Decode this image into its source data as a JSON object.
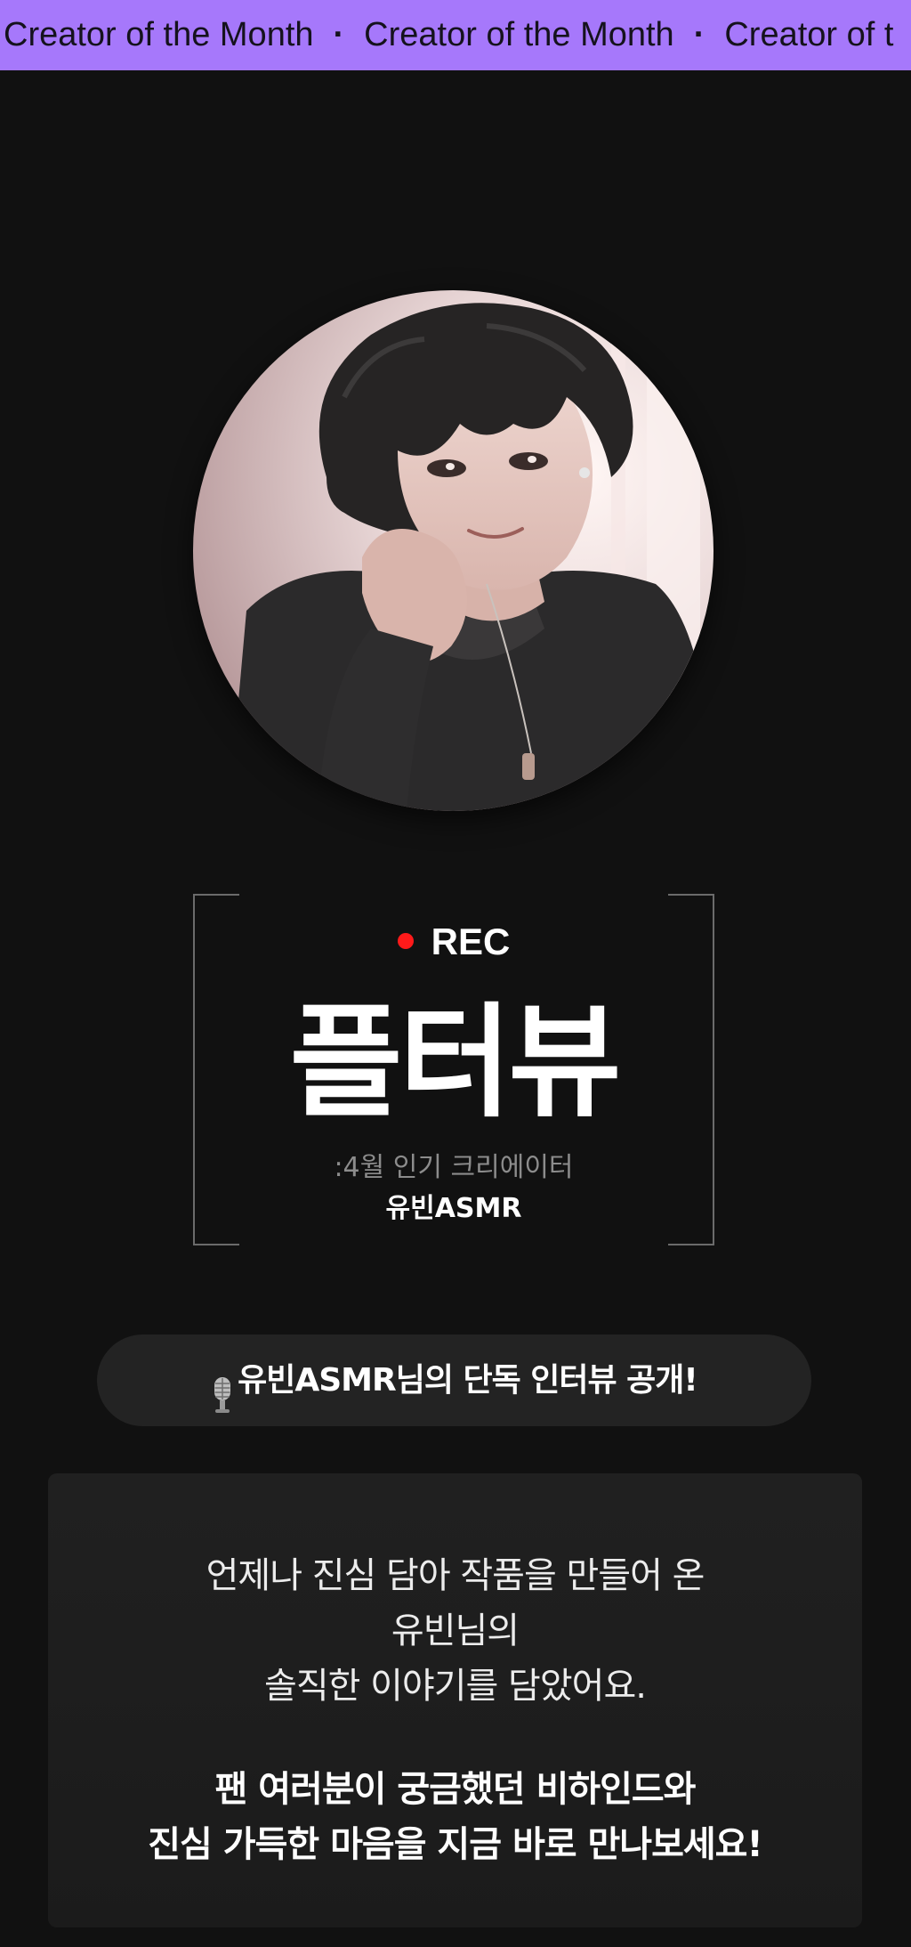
{
  "banner": {
    "items": [
      "Creator of the Month",
      "Creator of the Month",
      "Creator of t"
    ],
    "separator": "·",
    "background": "#a678fb"
  },
  "avatar": {
    "alt": "anime-style portrait of the creator"
  },
  "rec_panel": {
    "rec_label": "REC",
    "rec_color": "#ff1a1a",
    "title": "플터뷰",
    "subtitle": ":4월 인기 크리에이터",
    "creator_name": "유빈ASMR"
  },
  "interview_pill": {
    "icon": "microphone-icon",
    "label": "유빈ASMR님의 단독 인터뷰 공개!"
  },
  "intro_card": {
    "lines_light": [
      "언제나 진심 담아 작품을 만들어 온",
      "유빈님의",
      "솔직한 이야기를 담았어요."
    ],
    "lines_bold": [
      "팬 여러분이 궁금했던 비하인드와",
      "진심 가득한 마음을 지금 바로 만나보세요!"
    ]
  }
}
